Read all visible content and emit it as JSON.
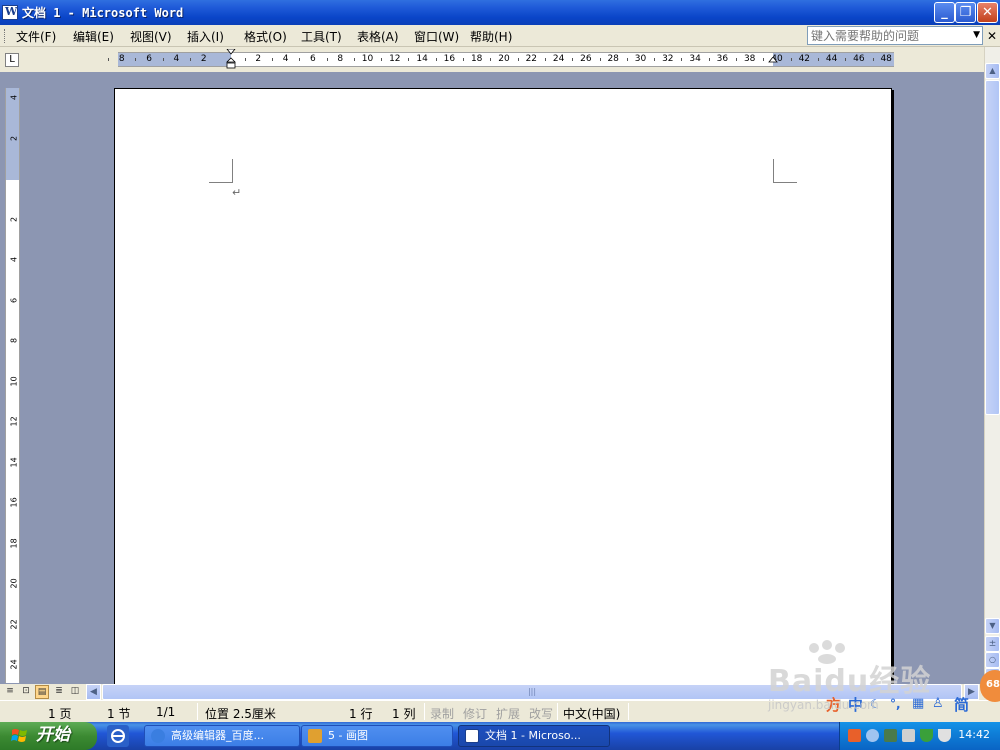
{
  "window": {
    "title": "文档 1 - Microsoft Word",
    "min_symbol": "_",
    "max_symbol": "❐",
    "close_symbol": "✕"
  },
  "menu": {
    "items": [
      {
        "label": "文件(F)"
      },
      {
        "label": "编辑(E)"
      },
      {
        "label": "视图(V)"
      },
      {
        "label": "插入(I)"
      },
      {
        "label": "格式(O)"
      },
      {
        "label": "工具(T)"
      },
      {
        "label": "表格(A)"
      },
      {
        "label": "窗口(W)"
      },
      {
        "label": "帮助(H)"
      }
    ],
    "help_placeholder": "键入需要帮助的问题",
    "dropdown_symbol": "▼",
    "close_doc_symbol": "✕"
  },
  "ruler": {
    "tab_selector": "L",
    "horizontal_labels": [
      "8",
      "6",
      "4",
      "2",
      "2",
      "4",
      "6",
      "8",
      "10",
      "12",
      "14",
      "16",
      "18",
      "20",
      "22",
      "24",
      "26",
      "28",
      "30",
      "32",
      "34",
      "36",
      "38",
      "40",
      "42",
      "44",
      "46",
      "48"
    ],
    "vertical_labels": [
      "4",
      "2",
      "2",
      "4",
      "6",
      "8",
      "10",
      "12",
      "14",
      "16",
      "18",
      "20",
      "22",
      "24"
    ]
  },
  "document": {
    "paragraph_mark": "↵"
  },
  "scrollbar": {
    "up": "▲",
    "down": "▼",
    "prev_page": "±",
    "browse": "○",
    "next_page": "∓",
    "left": "◀",
    "right": "▶",
    "grip": "|||"
  },
  "view_buttons": {
    "normal": "≡",
    "web": "⊡",
    "print": "▤",
    "outline": "≣",
    "reading": "◫"
  },
  "statusbar": {
    "page": "1 页",
    "section": "1 节",
    "page_of": "1/1",
    "position": "位置 2.5厘米",
    "line": "1 行",
    "column": "1 列",
    "rec": "录制",
    "trk": "修订",
    "ext": "扩展",
    "ovr": "改写",
    "language": "中文(中国)"
  },
  "taskbar": {
    "start_label": "开始",
    "tasks": [
      {
        "label": "高级编辑器_百度...",
        "icon_color": "#3a7ee0"
      },
      {
        "label": "5 - 画图",
        "icon_color": "#e0a030"
      },
      {
        "label": "文档 1 - Microso...",
        "icon_color": "#ffffff"
      }
    ],
    "clock": "14:42"
  },
  "ime": {
    "zhong": "中",
    "jian": "简"
  },
  "watermark": {
    "text": "Baidu经验",
    "url": "jingyan.baidu.com",
    "badge": "68"
  }
}
